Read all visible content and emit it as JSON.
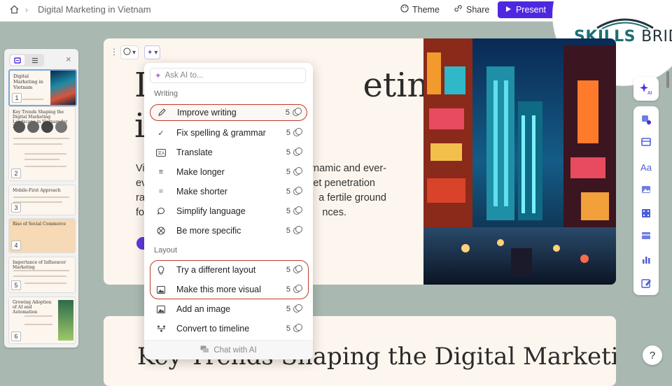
{
  "topbar": {
    "doc_title": "Digital Marketing in Vietnam",
    "theme_label": "Theme",
    "share_label": "Share",
    "present_label": "Present"
  },
  "brand": {
    "part1": "SKILLS",
    "part2": "BRIDGE"
  },
  "slides_panel": {
    "thumbs": [
      {
        "num": "1",
        "title": "Digital Marketing in Vietnam"
      },
      {
        "num": "2",
        "title": "Key Trends Shaping the Digital Marketing Landscape in Vietnam for 2024"
      },
      {
        "num": "3",
        "title": "Mobile-First Approach"
      },
      {
        "num": "4",
        "title": "Rise of Social Commerce"
      },
      {
        "num": "5",
        "title": "Importance of Influencer Marketing"
      },
      {
        "num": "6",
        "title": "Growing Adoption of AI and Automation"
      }
    ]
  },
  "slide1": {
    "title_line1": "D",
    "title_line1_end": "eting",
    "title_line2": "i",
    "body_lines": [
      "Vi",
      "ev",
      "ra",
      "fo"
    ],
    "body_right_lines": [
      "ynamic and ever-",
      "et penetration",
      "a fertile ground",
      "nces."
    ]
  },
  "slide2": {
    "title": "Key Trends Shaping the Digital Marketing"
  },
  "ai_menu": {
    "ask_placeholder": "Ask AI to...",
    "section_writing": "Writing",
    "section_layout": "Layout",
    "items": [
      {
        "label": "Improve writing",
        "cost": "5",
        "icon": "pen-icon"
      },
      {
        "label": "Fix spelling & grammar",
        "cost": "5",
        "icon": "check-icon"
      },
      {
        "label": "Translate",
        "cost": "5",
        "icon": "translate-icon"
      },
      {
        "label": "Make longer",
        "cost": "5",
        "icon": "lines-icon"
      },
      {
        "label": "Make shorter",
        "cost": "5",
        "icon": "short-lines-icon"
      },
      {
        "label": "Simplify language",
        "cost": "5",
        "icon": "speech-bubble-icon"
      },
      {
        "label": "Be more specific",
        "cost": "5",
        "icon": "target-icon"
      },
      {
        "label": "Try a different layout",
        "cost": "5",
        "icon": "lightbulb-icon"
      },
      {
        "label": "Make this more visual",
        "cost": "5",
        "icon": "image-icon"
      },
      {
        "label": "Add an image",
        "cost": "5",
        "icon": "image-add-icon"
      },
      {
        "label": "Convert to timeline",
        "cost": "5",
        "icon": "timeline-icon"
      }
    ],
    "footer_label": "Chat with AI"
  },
  "colors": {
    "accent": "#4f27e0",
    "highlight": "#c0392b",
    "brand_teal": "#1d6f73"
  },
  "help_label": "?"
}
